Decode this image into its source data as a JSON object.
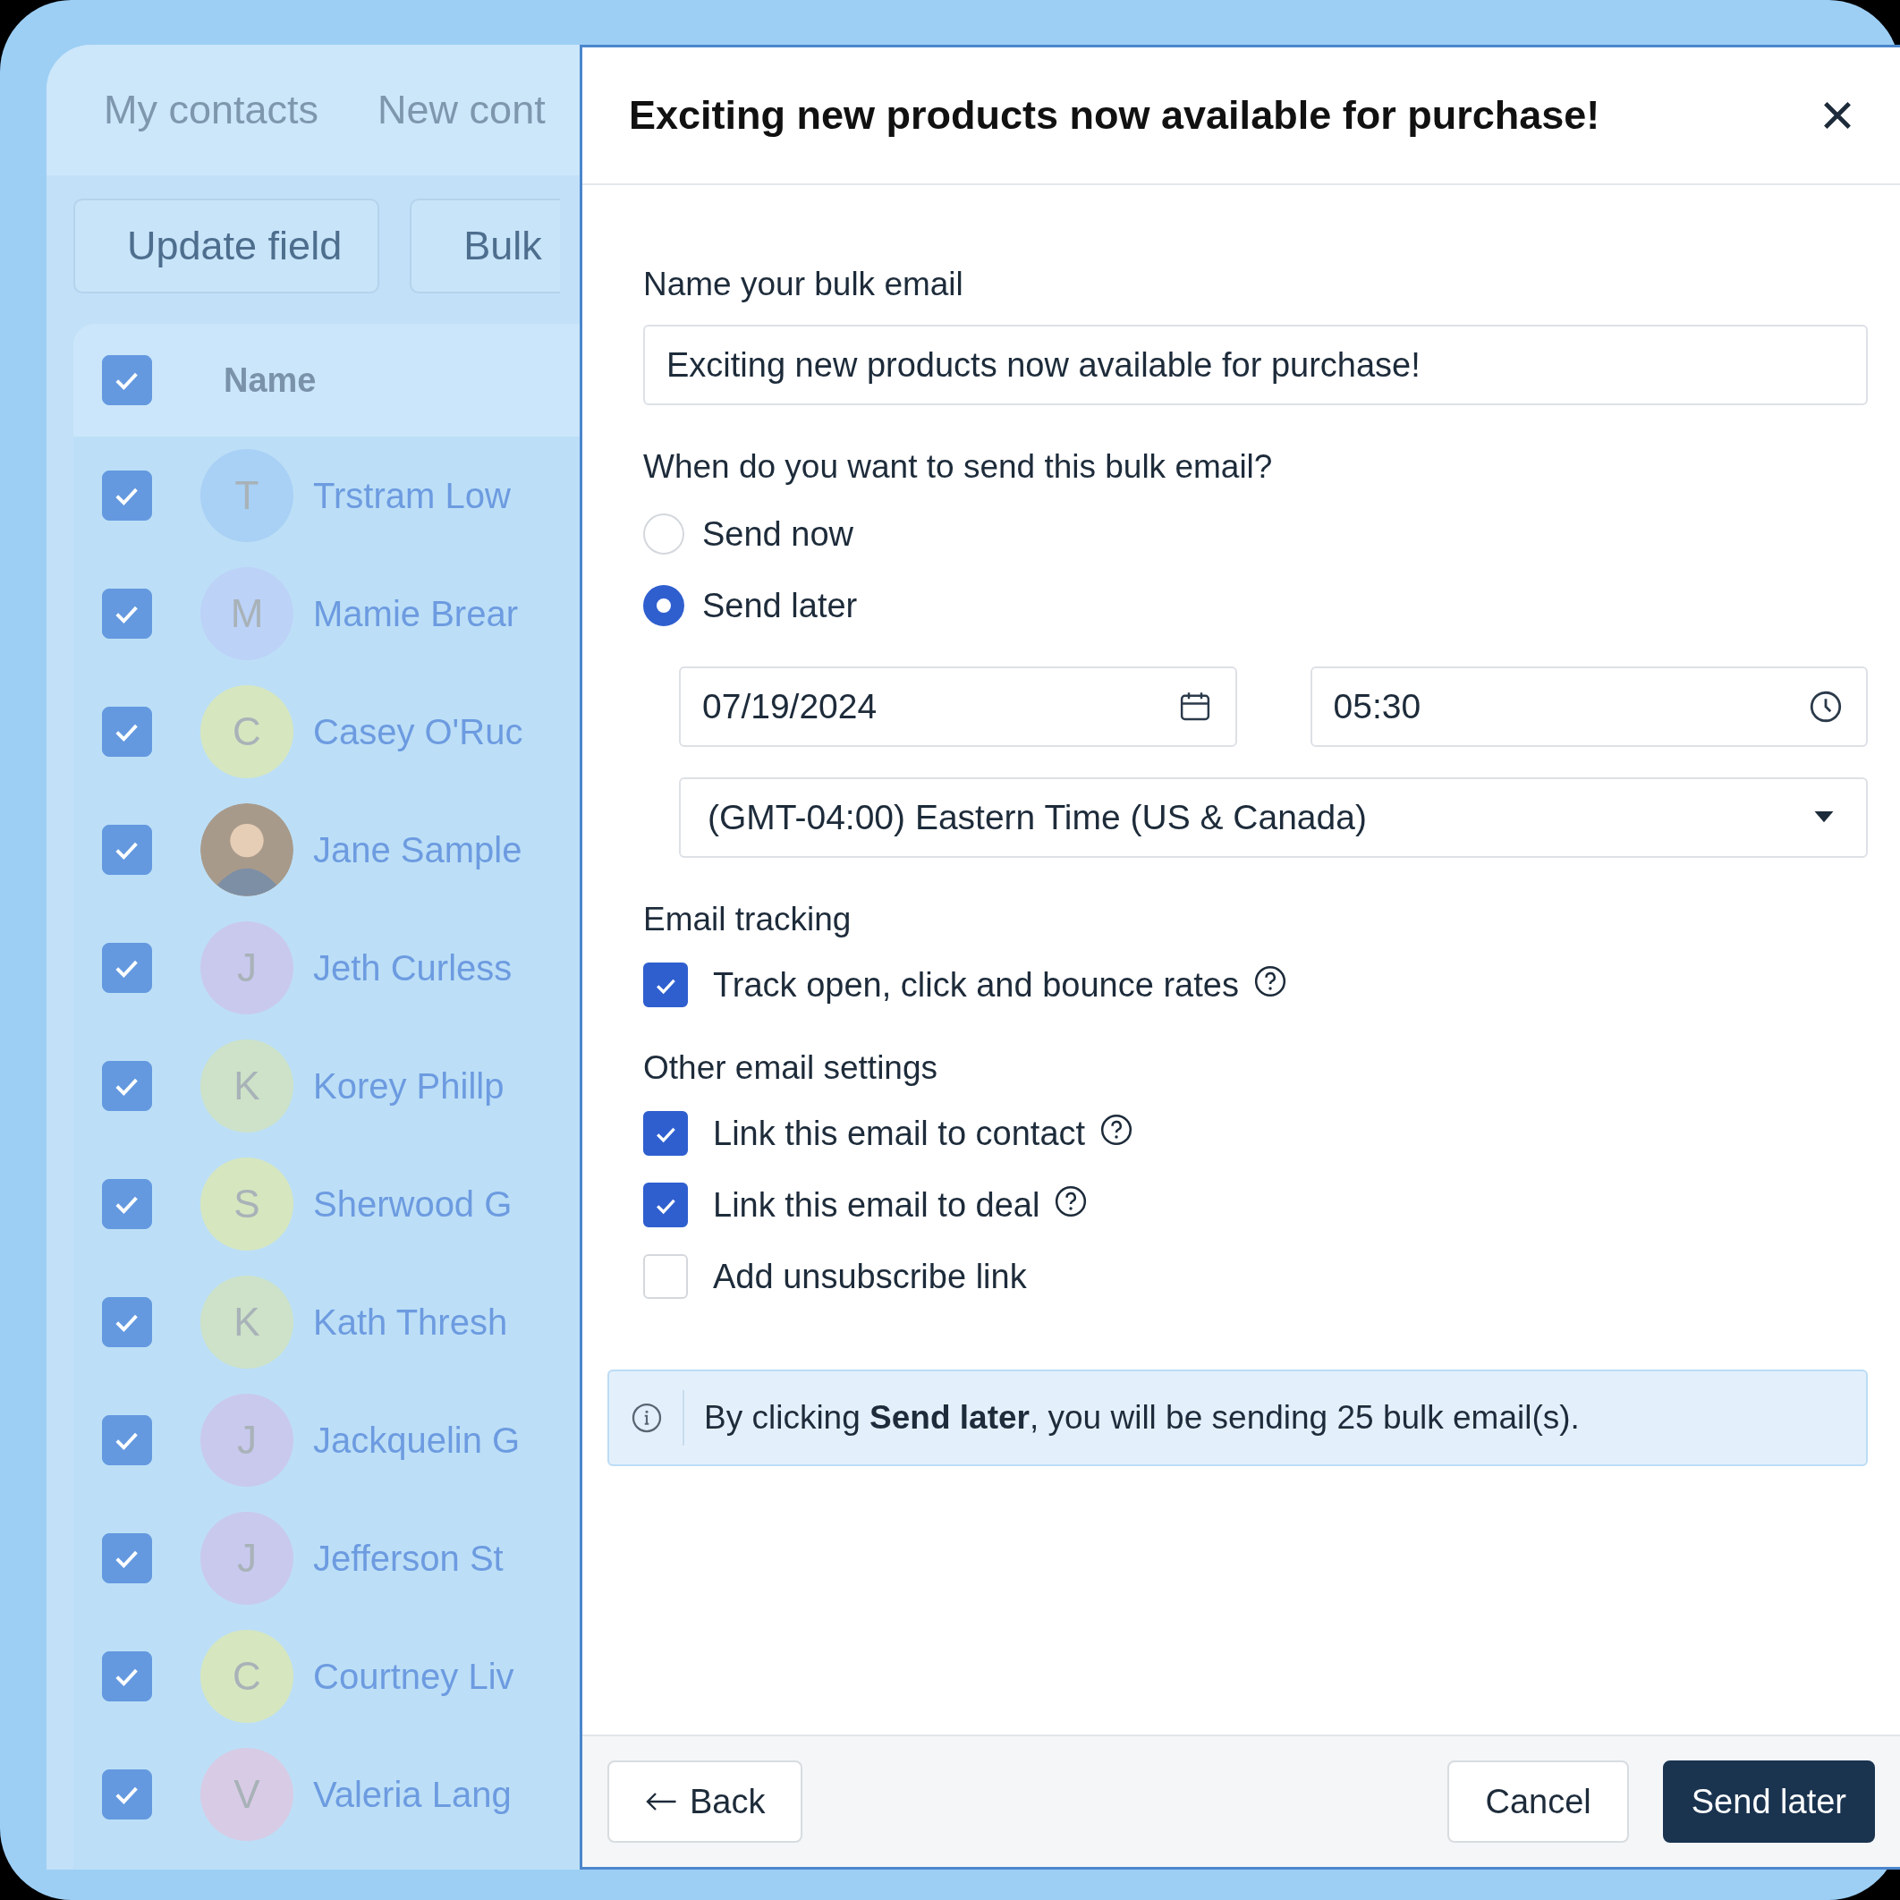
{
  "background": {
    "tabs": [
      {
        "label": "My contacts"
      },
      {
        "label": "New cont"
      }
    ],
    "actions": [
      {
        "label": "Update field"
      },
      {
        "label": "Bulk"
      }
    ],
    "table": {
      "select_all_checked": true,
      "column": "Name",
      "rows": [
        {
          "kind": "initial",
          "initial": "T",
          "name": "Trstram Low",
          "color": "#a9d0f5",
          "checked": true
        },
        {
          "kind": "initial",
          "initial": "M",
          "name": "Mamie Brear",
          "color": "#bcd2f7",
          "checked": true
        },
        {
          "kind": "initial",
          "initial": "C",
          "name": "Casey O'Ruc",
          "color": "#d6e6bf",
          "checked": true
        },
        {
          "kind": "photo",
          "name": "Jane Sample",
          "checked": true
        },
        {
          "kind": "initial",
          "initial": "J",
          "name": "Jeth Curless",
          "color": "#c9c9ee",
          "checked": true
        },
        {
          "kind": "initial",
          "initial": "K",
          "name": "Korey Phillp",
          "color": "#cde2c8",
          "checked": true
        },
        {
          "kind": "initial",
          "initial": "S",
          "name": "Sherwood G",
          "color": "#d6e6bf",
          "checked": true
        },
        {
          "kind": "initial",
          "initial": "K",
          "name": "Kath Thresh",
          "color": "#cde2c8",
          "checked": true
        },
        {
          "kind": "initial",
          "initial": "J",
          "name": "Jackquelin G",
          "color": "#c9c9ee",
          "checked": true
        },
        {
          "kind": "initial",
          "initial": "J",
          "name": "Jefferson St",
          "color": "#c9c9ee",
          "checked": true
        },
        {
          "kind": "initial",
          "initial": "C",
          "name": "Courtney Liv",
          "color": "#d6e6bf",
          "checked": true
        },
        {
          "kind": "initial",
          "initial": "V",
          "name": "Valeria Lang",
          "color": "#d8cbe5",
          "checked": true
        }
      ]
    }
  },
  "dialog": {
    "title": "Exciting new products now available for purchase!",
    "name_label": "Name your bulk email",
    "name_value": "Exciting new products now available for purchase!",
    "when_label": "When do you want to send this bulk email?",
    "send_options": [
      {
        "label": "Send now",
        "selected": false
      },
      {
        "label": "Send later",
        "selected": true
      }
    ],
    "date": "07/19/2024",
    "time": "05:30",
    "timezone": "(GMT-04:00) Eastern Time (US & Canada)",
    "sections": [
      {
        "title": "Email tracking",
        "options": [
          {
            "label": "Track open, click and bounce rates",
            "checked": true,
            "help": true
          }
        ]
      },
      {
        "title": "Other email settings",
        "options": [
          {
            "label": "Link this email to contact",
            "checked": true,
            "help": true
          },
          {
            "label": "Link this email to deal",
            "checked": true,
            "help": true
          },
          {
            "label": "Add unsubscribe link",
            "checked": false,
            "help": false
          }
        ]
      }
    ],
    "info": "By clicking **Send later**, you will be sending 25 bulk email(s).",
    "buttons": {
      "back": "Back",
      "cancel": "Cancel",
      "submit": "Send later"
    }
  }
}
